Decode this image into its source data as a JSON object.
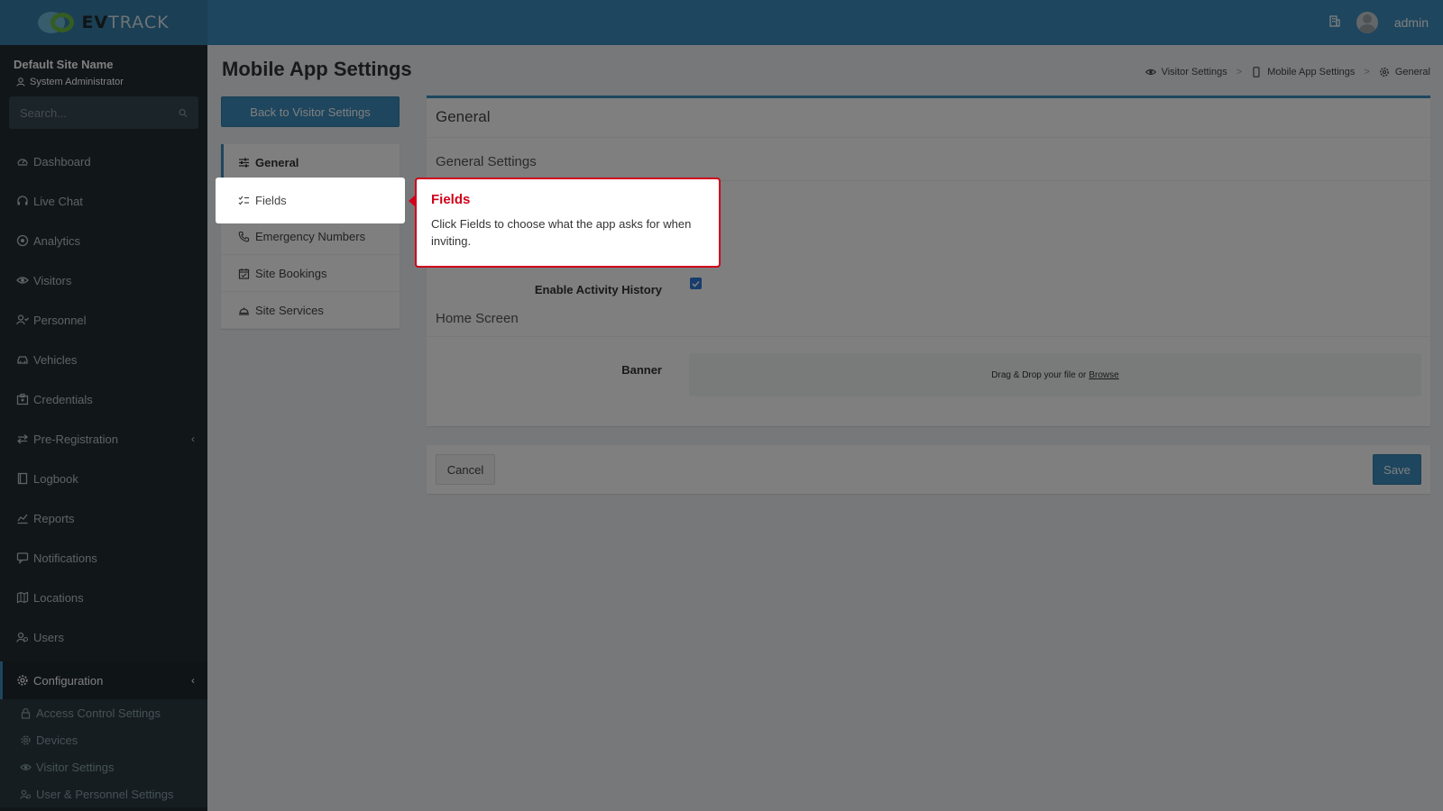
{
  "header": {
    "logo_text_bold": "EV",
    "logo_text_light": "TRACK",
    "user_name": "admin"
  },
  "sidebar": {
    "site_name": "Default Site Name",
    "role": "System Administrator",
    "search_placeholder": "Search...",
    "items": [
      {
        "label": "Dashboard",
        "icon": "dashboard-icon"
      },
      {
        "label": "Live Chat",
        "icon": "headset-icon"
      },
      {
        "label": "Analytics",
        "icon": "target-icon"
      },
      {
        "label": "Visitors",
        "icon": "eye-icon"
      },
      {
        "label": "Personnel",
        "icon": "user-check-icon"
      },
      {
        "label": "Vehicles",
        "icon": "car-icon"
      },
      {
        "label": "Credentials",
        "icon": "badge-icon"
      },
      {
        "label": "Pre-Registration",
        "icon": "exchange-icon"
      },
      {
        "label": "Logbook",
        "icon": "book-icon"
      },
      {
        "label": "Reports",
        "icon": "chart-icon"
      },
      {
        "label": "Notifications",
        "icon": "chat-icon"
      },
      {
        "label": "Locations",
        "icon": "map-icon"
      },
      {
        "label": "Users",
        "icon": "users-icon"
      },
      {
        "label": "Configuration",
        "icon": "gear-icon"
      }
    ],
    "subitems": [
      {
        "label": "Access Control Settings",
        "icon": "lock-icon"
      },
      {
        "label": "Devices",
        "icon": "cog-icon"
      },
      {
        "label": "Visitor Settings",
        "icon": "eye-icon"
      },
      {
        "label": "User & Personnel Settings",
        "icon": "users-icon"
      }
    ]
  },
  "page": {
    "title": "Mobile App Settings",
    "back_button": "Back to Visitor Settings",
    "breadcrumb": [
      "Visitor Settings",
      "Mobile App Settings",
      "General"
    ]
  },
  "nav": [
    {
      "label": "General",
      "icon": "sliders-icon"
    },
    {
      "label": "Fields",
      "icon": "checklist-icon"
    },
    {
      "label": "Emergency Numbers",
      "icon": "phone-icon"
    },
    {
      "label": "Site Bookings",
      "icon": "calendar-check-icon"
    },
    {
      "label": "Site Services",
      "icon": "service-bell-icon"
    }
  ],
  "card": {
    "title": "General",
    "section_general": "General Settings",
    "activity_label": "Enable Activity History",
    "activity_checked": true,
    "section_home": "Home Screen",
    "banner_label": "Banner",
    "dropzone_text": "Drag & Drop your file or",
    "dropzone_link": "Browse"
  },
  "footer": {
    "cancel": "Cancel",
    "save": "Save"
  },
  "tooltip": {
    "title": "Fields",
    "body": "Click Fields to choose what the app asks for when inviting."
  },
  "colors": {
    "primary": "#3c8dbc",
    "sidebar_bg": "#222d32",
    "tooltip_accent": "#d0021b"
  }
}
